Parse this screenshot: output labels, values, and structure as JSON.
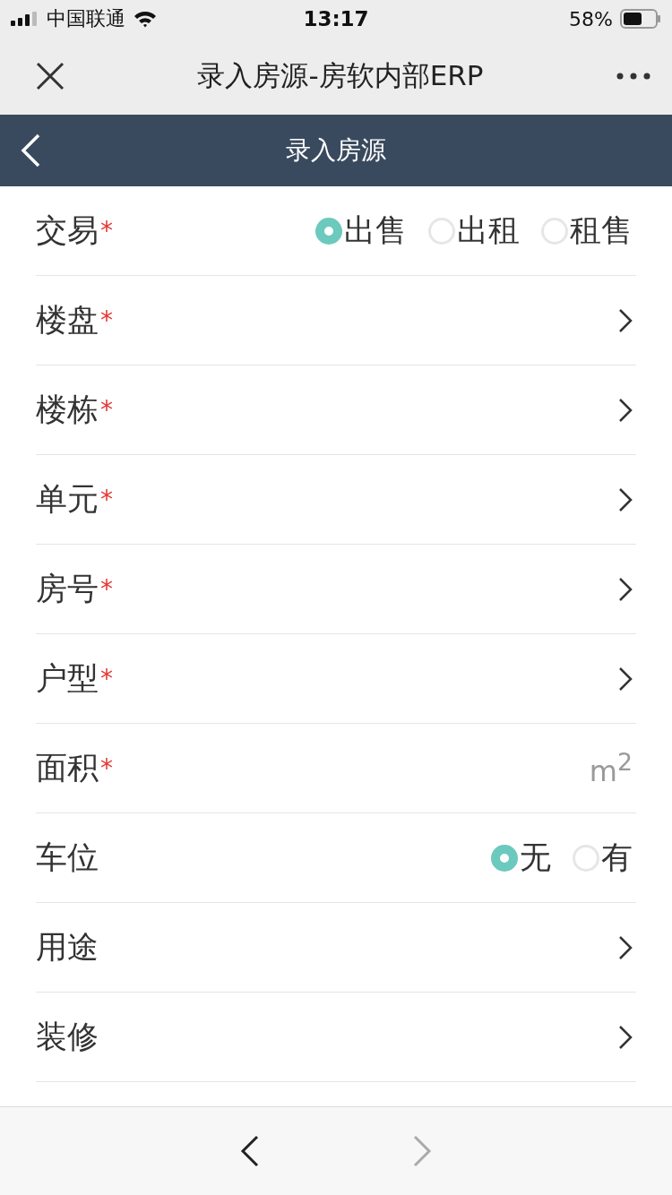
{
  "status_bar": {
    "carrier": "中国联通",
    "time": "13:17",
    "battery": "58%"
  },
  "window": {
    "title": "录入房源-房软内部ERP"
  },
  "header": {
    "title": "录入房源"
  },
  "form": [
    {
      "kind": "radio",
      "label": "交易",
      "required_mark": "*",
      "options": [
        {
          "label": "出售",
          "selected": true
        },
        {
          "label": "出租",
          "selected": false
        },
        {
          "label": "租售",
          "selected": false
        }
      ]
    },
    {
      "kind": "select",
      "label": "楼盘",
      "required_mark": "*"
    },
    {
      "kind": "select",
      "label": "楼栋",
      "required_mark": "*"
    },
    {
      "kind": "select",
      "label": "单元",
      "required_mark": "*"
    },
    {
      "kind": "select",
      "label": "房号",
      "required_mark": "*"
    },
    {
      "kind": "select",
      "label": "户型",
      "required_mark": "*"
    },
    {
      "kind": "input",
      "label": "面积",
      "required_mark": "*",
      "unit": "m$^{2}$"
    },
    {
      "kind": "radio",
      "label": "车位",
      "options": [
        {
          "label": "无",
          "selected": true
        },
        {
          "label": "有",
          "selected": false
        }
      ]
    },
    {
      "kind": "select",
      "label": "用途"
    },
    {
      "kind": "select",
      "label": "装修"
    }
  ],
  "toolbar": {
    "back_disabled": false,
    "forward_disabled": true
  }
}
